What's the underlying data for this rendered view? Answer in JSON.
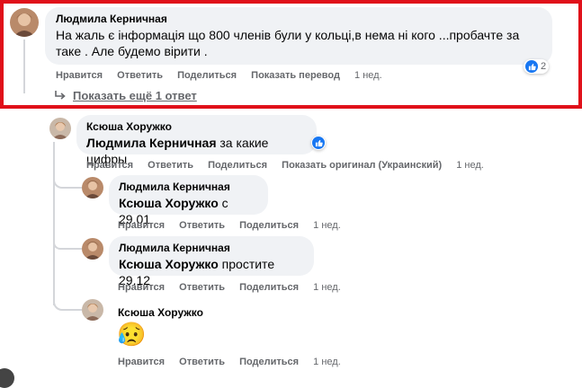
{
  "highlight_color": "#e0101a",
  "actions": {
    "like": "Нравится",
    "reply": "Ответить",
    "share": "Поделиться",
    "translate": "Показать перевод",
    "original": "Показать оригинал (Украинский)"
  },
  "comments": [
    {
      "author": "Людмила Керничная",
      "text": "На жаль є інформація що 800 членів були у кольці,в нема ні кого ...пробачте за таке . Але будемо вірити .",
      "time": "1 нед.",
      "reaction": {
        "icon": "thumbs-up-icon",
        "count": "2"
      }
    },
    {
      "author": "Ксюша Хоружко",
      "mention": "Людмила Керничная",
      "text": "за какие цифры",
      "time": "1 нед.",
      "reaction": {
        "icon": "thumbs-up-icon"
      }
    },
    {
      "author": "Людмила Керничная",
      "mention": "Ксюша Хоружко",
      "text": "с 29.01",
      "time": "1 нед."
    },
    {
      "author": "Людмила Керничная",
      "mention": "Ксюша Хоружко",
      "text": "простите 29.12",
      "time": "1 нед."
    },
    {
      "author": "Ксюша Хоружко",
      "emoji": "😥",
      "time": "1 нед."
    }
  ],
  "show_more": "Показать ещё 1 ответ"
}
